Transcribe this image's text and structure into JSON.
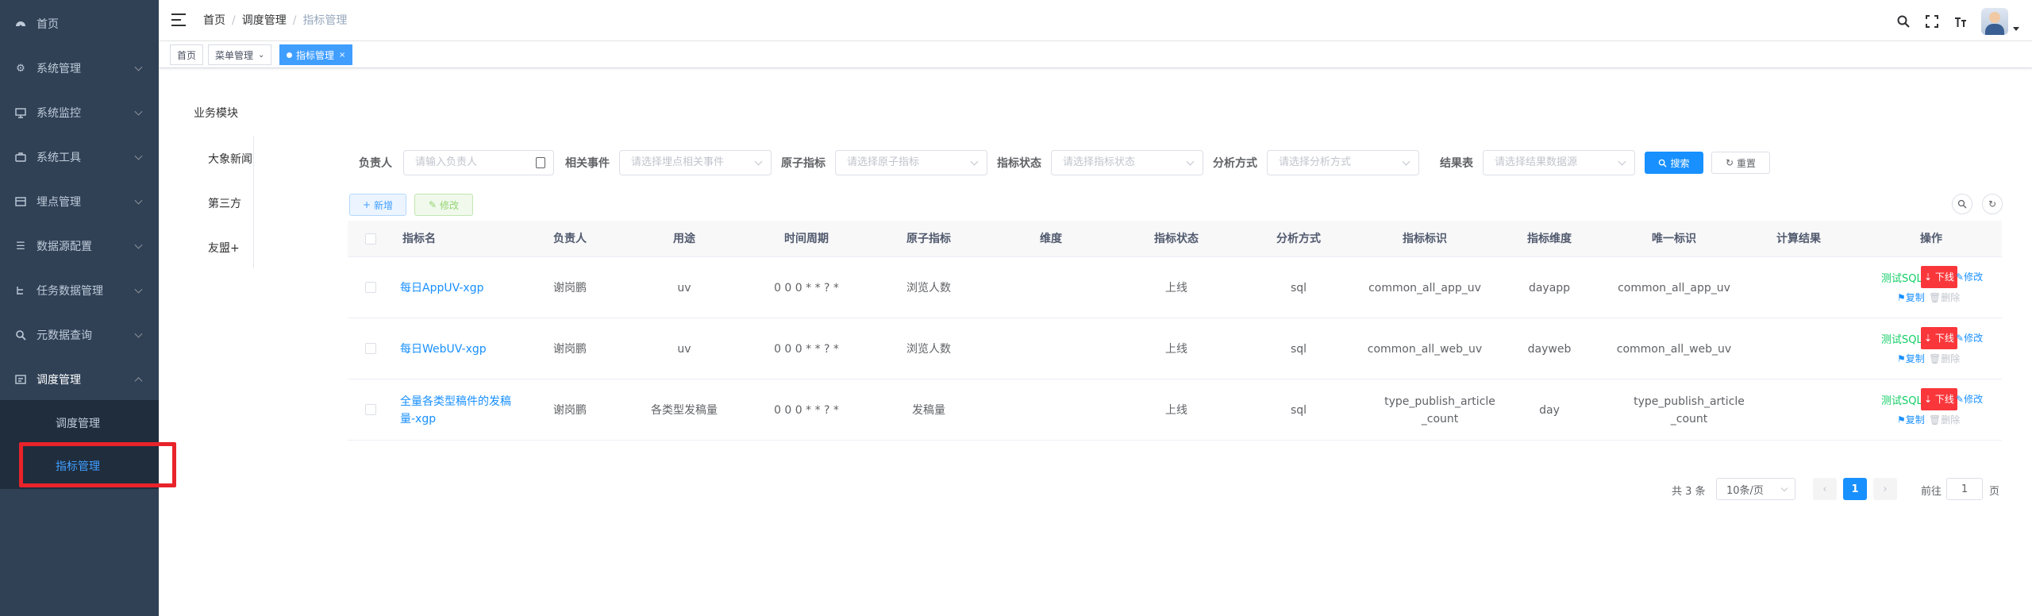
{
  "sidebar": {
    "items": [
      {
        "label": "首页",
        "icon": "dashboard-icon"
      },
      {
        "label": "系统管理",
        "icon": "gear-icon"
      },
      {
        "label": "系统监控",
        "icon": "monitor-icon"
      },
      {
        "label": "系统工具",
        "icon": "toolbox-icon"
      },
      {
        "label": "埋点管理",
        "icon": "tracking-icon"
      },
      {
        "label": "数据源配置",
        "icon": "list-icon"
      },
      {
        "label": "任务数据管理",
        "icon": "tree-icon"
      },
      {
        "label": "元数据查询",
        "icon": "search-icon"
      },
      {
        "label": "调度管理",
        "icon": "schedule-icon"
      }
    ],
    "sub_items": [
      {
        "label": "调度管理"
      },
      {
        "label": "指标管理"
      }
    ]
  },
  "navbar": {
    "breadcrumb": [
      "首页",
      "调度管理",
      "指标管理"
    ],
    "separator": "/"
  },
  "tags": [
    {
      "label": "首页"
    },
    {
      "label": "菜单管理"
    },
    {
      "label": "指标管理",
      "close": "×"
    }
  ],
  "left_panel": {
    "title": "业务模块",
    "items": [
      "大象新闻",
      "第三方",
      "友盟+"
    ]
  },
  "search": {
    "owner_label": "负责人",
    "owner_placeholder": "请输入负责人",
    "event_label": "相关事件",
    "event_placeholder": "请选择埋点相关事件",
    "atom_label": "原子指标",
    "atom_placeholder": "请选择原子指标",
    "status_label": "指标状态",
    "status_placeholder": "请选择指标状态",
    "method_label": "分析方式",
    "method_placeholder": "请选择分析方式",
    "result_label": "结果表",
    "result_placeholder": "请选择结果数据源",
    "search_button": "搜索",
    "reset_button": "重置"
  },
  "toolbar": {
    "add_button": "新增",
    "edit_button": "修改"
  },
  "table": {
    "columns": [
      "指标名",
      "负责人",
      "用途",
      "时间周期",
      "原子指标",
      "维度",
      "指标状态",
      "分析方式",
      "指标标识",
      "指标维度",
      "唯一标识",
      "计算结果",
      "操作"
    ],
    "rows": [
      {
        "name": "每日AppUV-xgp",
        "owner": "谢岗鹏",
        "usage": "uv",
        "period": "0 0 0 * * ? *",
        "atom": "浏览人数",
        "dim": "",
        "status": "上线",
        "method": "sql",
        "mark": "common_all_app_uv",
        "metric_dim": "dayapp",
        "uid": "common_all_app_uv",
        "result": ""
      },
      {
        "name": "每日WebUV-xgp",
        "owner": "谢岗鹏",
        "usage": "uv",
        "period": "0 0 0 * * ? *",
        "atom": "浏览人数",
        "dim": "",
        "status": "上线",
        "method": "sql",
        "mark": "common_all_web_uv",
        "metric_dim": "dayweb",
        "uid": "common_all_web_uv",
        "result": ""
      },
      {
        "name": "全量各类型稿件的发稿量-xgp",
        "owner": "谢岗鹏",
        "usage": "各类型发稿量",
        "period": "0 0 0 * * ? *",
        "atom": "发稿量",
        "dim": "",
        "status": "上线",
        "method": "sql",
        "mark": "type_publish_article_count",
        "metric_dim": "day",
        "uid": "type_publish_article_count",
        "result": ""
      }
    ],
    "ops": {
      "test_sql": "测试SQL",
      "offline": "下线",
      "edit": "修改",
      "copy": "复制",
      "delete": "删除"
    }
  },
  "pagination": {
    "total": "共 3 条",
    "page_size": "10条/页",
    "current_page": "1",
    "goto_label": "前往",
    "goto_value": "1",
    "page_suffix": "页"
  },
  "colors": {
    "sidebar_bg": "#304156",
    "primary": "#1890ff",
    "danger": "#f9373b",
    "success": "#13ce66"
  }
}
